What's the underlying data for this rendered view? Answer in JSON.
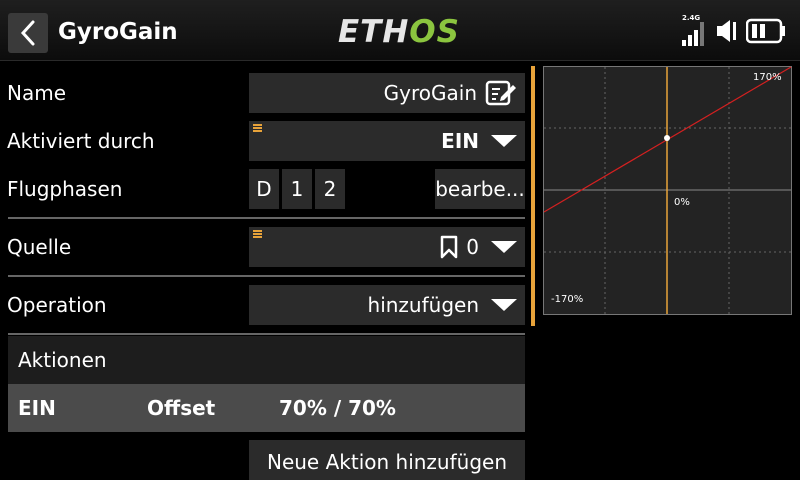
{
  "header": {
    "title": "GyroGain",
    "logo_main": "ETH",
    "logo_accent": "OS",
    "signal_band": "2.4G"
  },
  "form": {
    "name": {
      "label": "Name",
      "value": "GyroGain"
    },
    "activated_by": {
      "label": "Aktiviert durch",
      "value": "EIN"
    },
    "flight_modes": {
      "label": "Flugphasen",
      "items": [
        "D",
        "1",
        "2"
      ],
      "edit_label": "bearbe..."
    },
    "source": {
      "label": "Quelle",
      "value": "0"
    },
    "operation": {
      "label": "Operation",
      "value": "hinzufügen"
    }
  },
  "actions": {
    "header": "Aktionen",
    "rows": [
      {
        "trigger": "EIN",
        "type": "Offset",
        "value": "70% / 70%"
      }
    ],
    "add_button": "Neue Aktion hinzufügen"
  },
  "graph": {
    "top_right_label": "170%",
    "center_label": "0%",
    "bottom_left_label": "-170%",
    "line_color": "#d42020",
    "cursor_color": "#e8a33a"
  }
}
